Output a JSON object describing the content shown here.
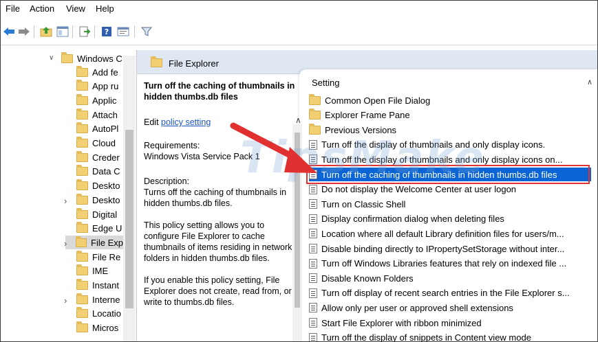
{
  "menu": [
    "File",
    "Action",
    "View",
    "Help"
  ],
  "toolbar": {
    "icons": [
      "back-arrow-icon",
      "forward-arrow-icon",
      "up-folder-icon",
      "show-hide-tree-icon",
      "export-list-icon",
      "help-icon",
      "properties-icon",
      "filter-icon"
    ]
  },
  "tree": {
    "root": "Windows C",
    "items": [
      {
        "label": "Add fe",
        "expandable": false
      },
      {
        "label": "App ru",
        "expandable": false
      },
      {
        "label": "Applic",
        "expandable": false
      },
      {
        "label": "Attach",
        "expandable": false
      },
      {
        "label": "AutoPl",
        "expandable": false
      },
      {
        "label": "Cloud",
        "expandable": false
      },
      {
        "label": "Creder",
        "expandable": false
      },
      {
        "label": "Data C",
        "expandable": false
      },
      {
        "label": "Deskto",
        "expandable": false
      },
      {
        "label": "Deskto",
        "expandable": true
      },
      {
        "label": "Digital",
        "expandable": false
      },
      {
        "label": "Edge U",
        "expandable": false
      },
      {
        "label": "File Exp",
        "expandable": true,
        "selected": true
      },
      {
        "label": "File Re",
        "expandable": false
      },
      {
        "label": "IME",
        "expandable": false
      },
      {
        "label": "Instant",
        "expandable": false
      },
      {
        "label": "Interne",
        "expandable": true
      },
      {
        "label": "Locatio",
        "expandable": false
      },
      {
        "label": "Micros",
        "expandable": false
      }
    ]
  },
  "detail": {
    "header": "File Explorer",
    "title": "Turn off the caching of thumbnails in hidden thumbs.db files",
    "edit_prefix": "Edit ",
    "edit_link": "policy setting",
    "requirements_label": "Requirements:",
    "requirements_value": "Windows Vista Service Pack 1",
    "description_label": "Description:",
    "description_text": "Turns off the caching of thumbnails in hidden thumbs.db files.",
    "para1": "This policy setting allows you to configure File Explorer to cache thumbnails of items residing in network folders in hidden thumbs.db files.",
    "para2": "If you enable this policy setting, File Explorer does not create, read from, or write to thumbs.db files."
  },
  "list": {
    "column_header": "Setting",
    "rows": [
      {
        "label": "Common Open File Dialog",
        "type": "folder"
      },
      {
        "label": "Explorer Frame Pane",
        "type": "folder"
      },
      {
        "label": "Previous Versions",
        "type": "folder"
      },
      {
        "label": "Turn off the display of thumbnails and only display icons.",
        "type": "setting"
      },
      {
        "label": "Turn off the display of thumbnails and only display icons on...",
        "type": "setting"
      },
      {
        "label": "Turn off the caching of thumbnails in hidden thumbs.db files",
        "type": "setting",
        "selected": true
      },
      {
        "label": "Do not display the Welcome Center at user logon",
        "type": "setting"
      },
      {
        "label": "Turn on Classic Shell",
        "type": "setting"
      },
      {
        "label": "Display confirmation dialog when deleting files",
        "type": "setting"
      },
      {
        "label": "Location where all default Library definition files for users/m...",
        "type": "setting"
      },
      {
        "label": "Disable binding directly to IPropertySetStorage without inter...",
        "type": "setting"
      },
      {
        "label": "Turn off Windows Libraries features that rely on indexed file ...",
        "type": "setting"
      },
      {
        "label": "Disable Known Folders",
        "type": "setting"
      },
      {
        "label": "Turn off display of recent search entries in the File Explorer s...",
        "type": "setting"
      },
      {
        "label": "Allow only per user or approved shell extensions",
        "type": "setting"
      },
      {
        "label": "Start File Explorer with ribbon minimized",
        "type": "setting"
      },
      {
        "label": "Turn off the display of snippets in Content view mode",
        "type": "setting"
      }
    ]
  },
  "watermark": "TipsMake",
  "colors": {
    "selection": "#0a64d6",
    "highlight": "#e03030",
    "header_bg": "#dfe7f2",
    "folder": "#f2cf72"
  }
}
